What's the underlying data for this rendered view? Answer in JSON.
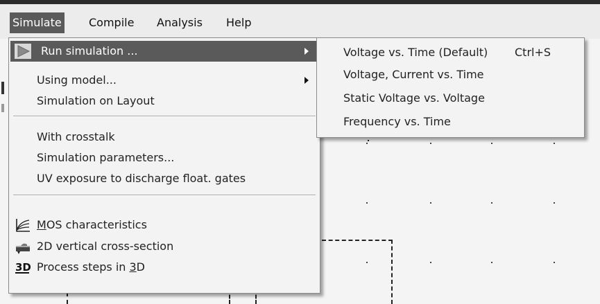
{
  "menubar": {
    "items": [
      {
        "label": "Simulate"
      },
      {
        "label": "Compile"
      },
      {
        "label": "Analysis"
      },
      {
        "label": "Help"
      }
    ]
  },
  "simulate_menu": {
    "items": [
      {
        "label": "Run simulation ...",
        "icon": "play-icon",
        "has_submenu": true,
        "highlighted": true
      },
      {
        "label": "Using model...",
        "has_submenu": true
      },
      {
        "label": "Simulation on Layout"
      },
      {
        "label": "With crosstalk"
      },
      {
        "label": "Simulation parameters..."
      },
      {
        "label": "UV exposure to discharge float. gates"
      },
      {
        "label_prefix": "",
        "label_mnemonic": "M",
        "label_suffix": "OS characteristics",
        "icon": "mos-curves-icon"
      },
      {
        "label": "2D vertical cross-section",
        "icon": "cross-section-icon"
      },
      {
        "label_prefix": "Process steps in ",
        "label_mnemonic": "3",
        "label_suffix": "D",
        "icon": "3d-icon",
        "icon_text": "3D"
      }
    ]
  },
  "run_submenu": {
    "items": [
      {
        "label": "Voltage vs. Time (Default)",
        "shortcut": "Ctrl+S"
      },
      {
        "label": "Voltage, Current vs. Time"
      },
      {
        "label": "Static Voltage vs. Voltage"
      },
      {
        "label": "Frequency vs. Time"
      }
    ]
  },
  "colors": {
    "highlight": "#5a5a5a",
    "menu_bg": "#f3f3f3",
    "canvas_bg": "#f4f4f4"
  }
}
